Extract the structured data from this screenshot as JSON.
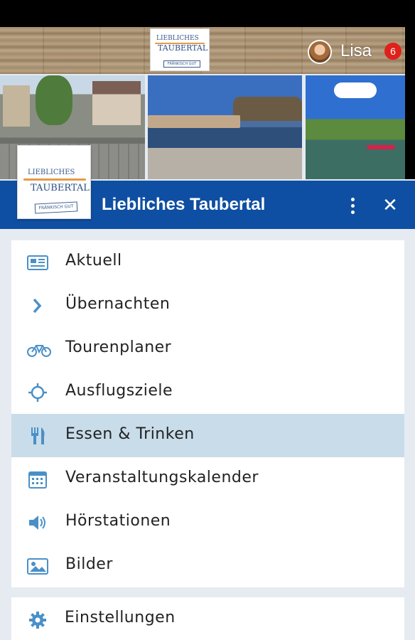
{
  "header": {
    "user_name": "Lisa",
    "notification_count": "6",
    "logo_text_line1": "LIEBLICHES",
    "logo_text_line2": "TAUBERTAL",
    "logo_stamp": "FRÄNKISCH GUT"
  },
  "navbar": {
    "title": "Liebliches Taubertal"
  },
  "colors": {
    "navbar": "#0f4fa3",
    "icon": "#4a90c8",
    "active_item": "#c8dcea",
    "badge": "#e0201a"
  },
  "menu": {
    "items": [
      {
        "label": "Aktuell",
        "icon": "newspaper-icon"
      },
      {
        "label": "Übernachten",
        "icon": "chevron-right-icon"
      },
      {
        "label": "Tourenplaner",
        "icon": "bicycle-icon"
      },
      {
        "label": "Ausflugsziele",
        "icon": "sun-icon"
      },
      {
        "label": "Essen & Trinken",
        "icon": "cutlery-icon",
        "active": true
      },
      {
        "label": "Veranstaltungskalender",
        "icon": "calendar-icon"
      },
      {
        "label": "Hörstationen",
        "icon": "speaker-icon"
      },
      {
        "label": "Bilder",
        "icon": "image-icon"
      }
    ]
  },
  "settings": {
    "label": "Einstellungen",
    "icon": "gear-icon"
  }
}
